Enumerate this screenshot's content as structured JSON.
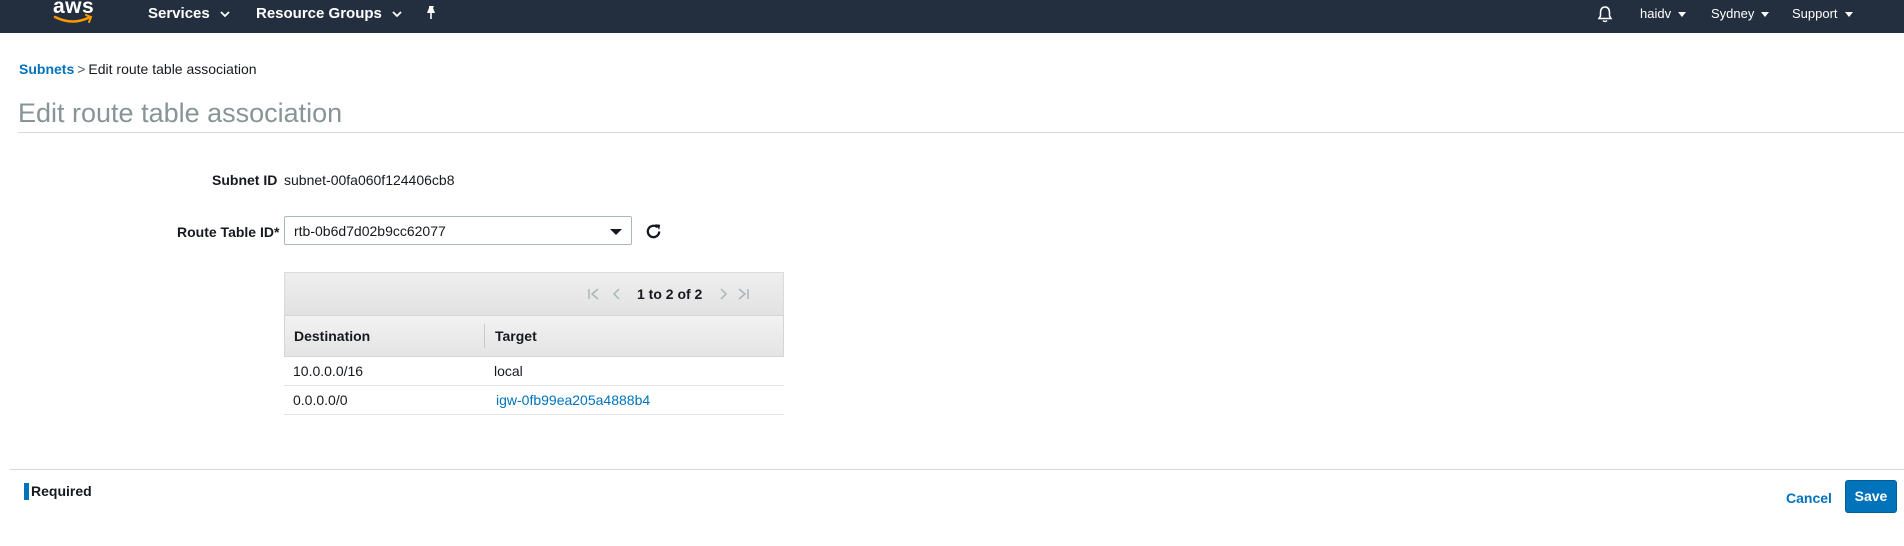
{
  "topbar": {
    "logo_text": "aws",
    "services_label": "Services",
    "resource_groups_label": "Resource Groups",
    "user_label": "haidv",
    "region_label": "Sydney",
    "support_label": "Support",
    "icons": [
      "pin-icon",
      "bell-icon",
      "chevron-down-icon"
    ]
  },
  "breadcrumb": {
    "parent": "Subnets",
    "separator": ">",
    "current": "Edit route table association"
  },
  "page_title": "Edit route table association",
  "form": {
    "subnet_id_label": "Subnet ID",
    "subnet_id_value": "subnet-00fa060f124406cb8",
    "route_table_label": "Route Table ID*",
    "route_table_value": "rtb-0b6d7d02b9cc62077"
  },
  "routes_table": {
    "pagination_text": "1 to 2 of 2",
    "columns": [
      "Destination",
      "Target"
    ],
    "rows": [
      {
        "destination": "10.0.0.0/16",
        "target": "local"
      },
      {
        "destination": "0.0.0.0/0",
        "target": "igw-0fb99ea205a4888b4"
      }
    ]
  },
  "footer": {
    "required_mark": "*",
    "required_label": "Required",
    "cancel_label": "Cancel",
    "save_label": "Save"
  },
  "colors": {
    "topbar": "#232f3e",
    "link": "#0073bb",
    "primary_button": "#0073bb",
    "title_gray": "#879596"
  }
}
